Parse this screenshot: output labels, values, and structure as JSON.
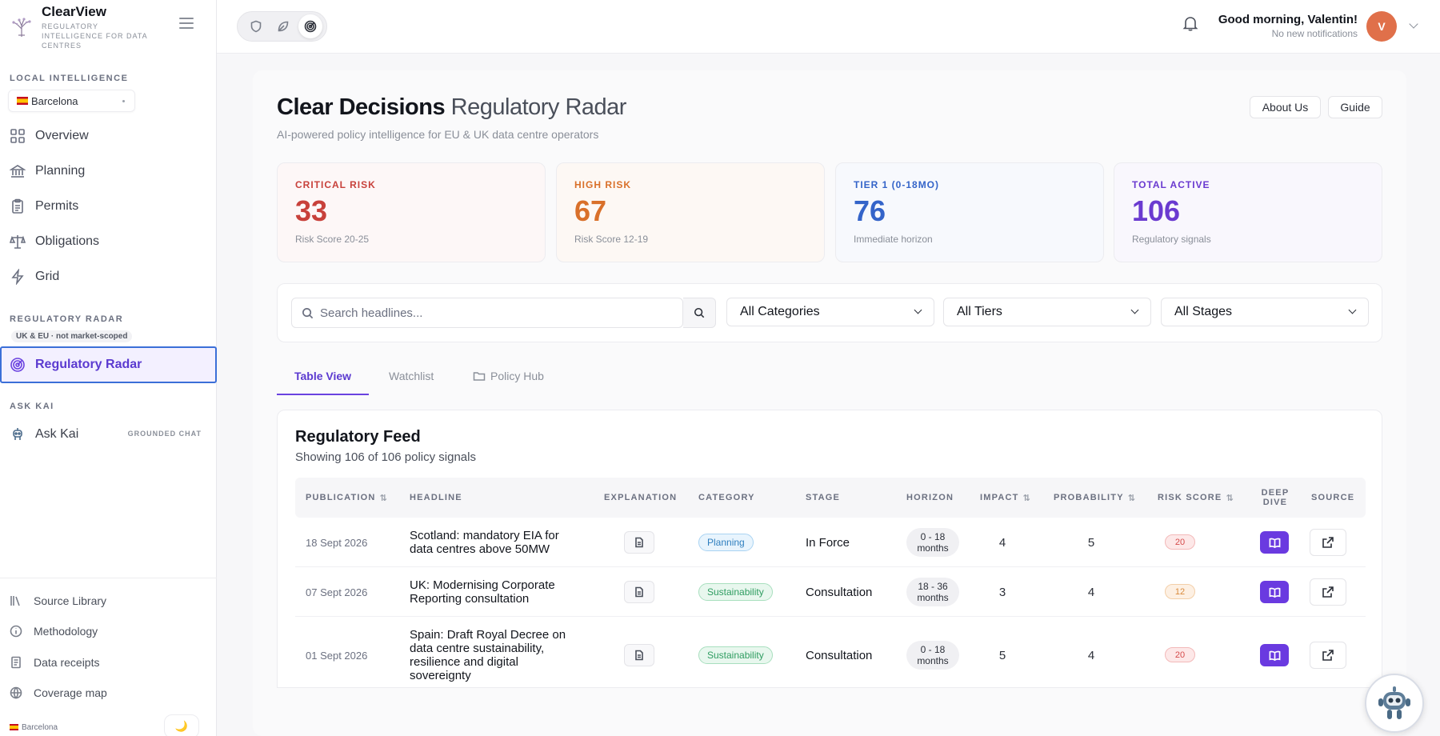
{
  "brand": {
    "name": "ClearView",
    "tagline": "REGULATORY INTELLIGENCE FOR DATA CENTRES"
  },
  "sidebar": {
    "local_label": "LOCAL INTELLIGENCE",
    "location": "Barcelona",
    "local_items": [
      {
        "label": "Overview",
        "icon": "grid-icon"
      },
      {
        "label": "Planning",
        "icon": "bank-icon"
      },
      {
        "label": "Permits",
        "icon": "clipboard-icon"
      },
      {
        "label": "Obligations",
        "icon": "scale-icon"
      },
      {
        "label": "Grid",
        "icon": "bolt-icon"
      }
    ],
    "radar_label": "REGULATORY RADAR",
    "radar_scope": "UK & EU · not market-scoped",
    "radar_item": "Regulatory Radar",
    "kai_label": "ASK KAI",
    "kai_item": "Ask Kai",
    "kai_badge": "GROUNDED CHAT",
    "footer_items": [
      {
        "label": "Source Library",
        "icon": "library-icon"
      },
      {
        "label": "Methodology",
        "icon": "info-icon"
      },
      {
        "label": "Data receipts",
        "icon": "receipt-icon"
      },
      {
        "label": "Coverage map",
        "icon": "globe-icon"
      }
    ],
    "footer_location": "Barcelona",
    "theme_icon": "🌙"
  },
  "topbar": {
    "greeting": "Good morning, Valentin!",
    "notifications": "No new notifications",
    "avatar_initial": "V"
  },
  "header": {
    "title_strong": "Clear Decisions",
    "title_light": "Regulatory Radar",
    "subtitle": "AI-powered policy intelligence for EU & UK data centre operators",
    "about_label": "About Us",
    "guide_label": "Guide"
  },
  "stats": [
    {
      "label": "CRITICAL RISK",
      "value": "33",
      "sub": "Risk Score 20-25",
      "color": "#c8413b",
      "bg": "#fdf7f7"
    },
    {
      "label": "HIGH RISK",
      "value": "67",
      "sub": "Risk Score 12-19",
      "color": "#d9702a",
      "bg": "#fdf8f4"
    },
    {
      "label": "TIER 1 (0-18MO)",
      "value": "76",
      "sub": "Immediate horizon",
      "color": "#3464c9",
      "bg": "#f7f9fd"
    },
    {
      "label": "TOTAL ACTIVE",
      "value": "106",
      "sub": "Regulatory signals",
      "color": "#6a3ad0",
      "bg": "#f9f7fd"
    }
  ],
  "filters": {
    "search_placeholder": "Search headlines...",
    "category": "All Categories",
    "tier": "All Tiers",
    "stage": "All Stages"
  },
  "tabs": [
    {
      "label": "Table View"
    },
    {
      "label": "Watchlist"
    },
    {
      "label": "Policy Hub"
    }
  ],
  "feed": {
    "title": "Regulatory Feed",
    "subtitle": "Showing 106 of 106 policy signals",
    "columns": {
      "publication": "PUBLICATION",
      "headline": "HEADLINE",
      "explanation": "EXPLANATION",
      "category": "CATEGORY",
      "stage": "STAGE",
      "horizon": "HORIZON",
      "impact": "IMPACT",
      "probability": "PROBABILITY",
      "risk_score": "RISK SCORE",
      "deep_dive_1": "DEEP",
      "deep_dive_2": "DIVE",
      "source": "SOURCE"
    },
    "rows": [
      {
        "date": "18 Sept 2026",
        "headline": "Scotland: mandatory EIA for data centres above 50MW",
        "category": "Planning",
        "stage": "In Force",
        "horizon_1": "0 - 18",
        "horizon_2": "months",
        "impact": "4",
        "probability": "5",
        "risk": "20"
      },
      {
        "date": "07 Sept 2026",
        "headline": "UK: Modernising Corporate Reporting consultation",
        "category": "Sustainability",
        "stage": "Consultation",
        "horizon_1": "18 - 36",
        "horizon_2": "months",
        "impact": "3",
        "probability": "4",
        "risk": "12"
      },
      {
        "date": "01 Sept 2026",
        "headline": "Spain: Draft Royal Decree on data centre sustainability, resilience and digital sovereignty",
        "category": "Sustainability",
        "stage": "Consultation",
        "horizon_1": "0 - 18",
        "horizon_2": "months",
        "impact": "5",
        "probability": "4",
        "risk": "20"
      }
    ]
  }
}
